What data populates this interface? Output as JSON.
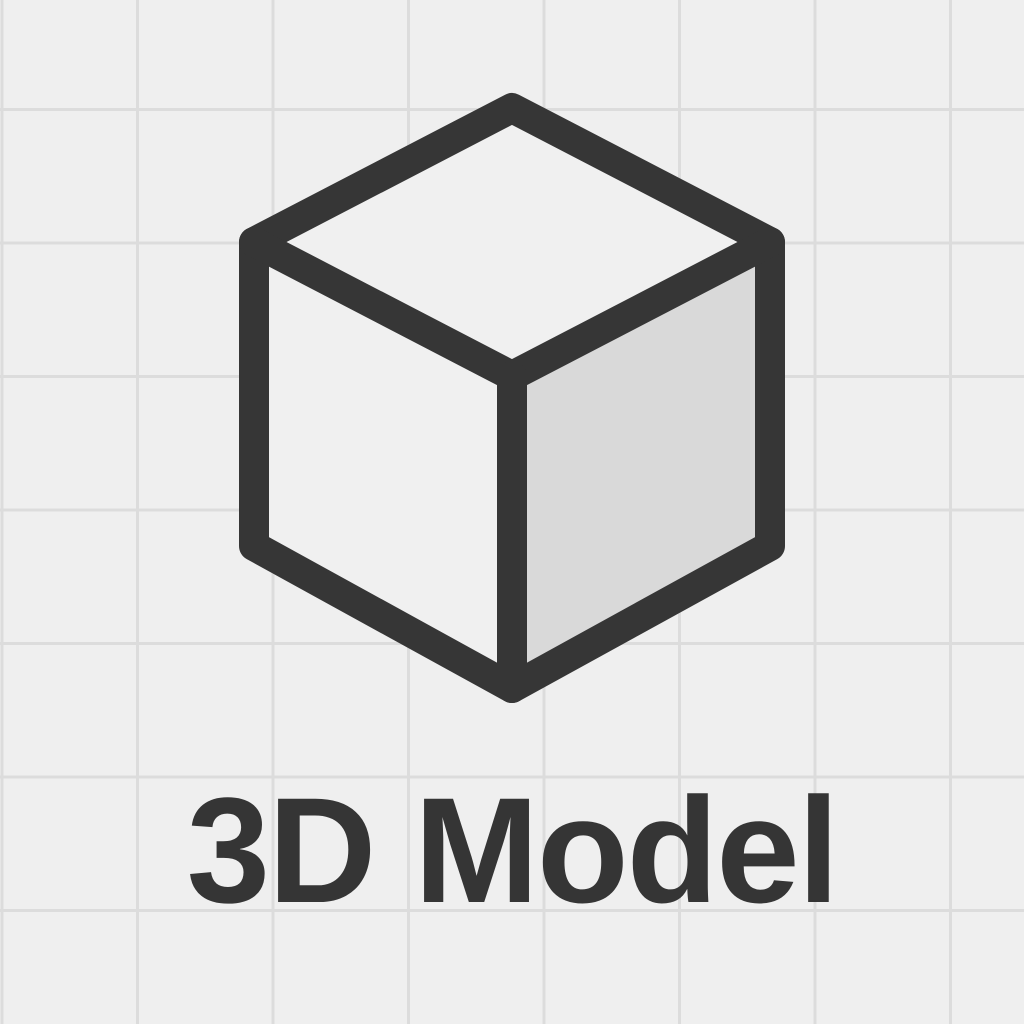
{
  "icon": {
    "name": "cube-icon"
  },
  "label": {
    "text": "3D Model"
  },
  "colors": {
    "background": "#efefef",
    "grid": "#dcdcdc",
    "stroke": "#363636",
    "face_light": "#f0f0f0",
    "face_shaded": "#d9d9d9",
    "text": "#353535"
  }
}
